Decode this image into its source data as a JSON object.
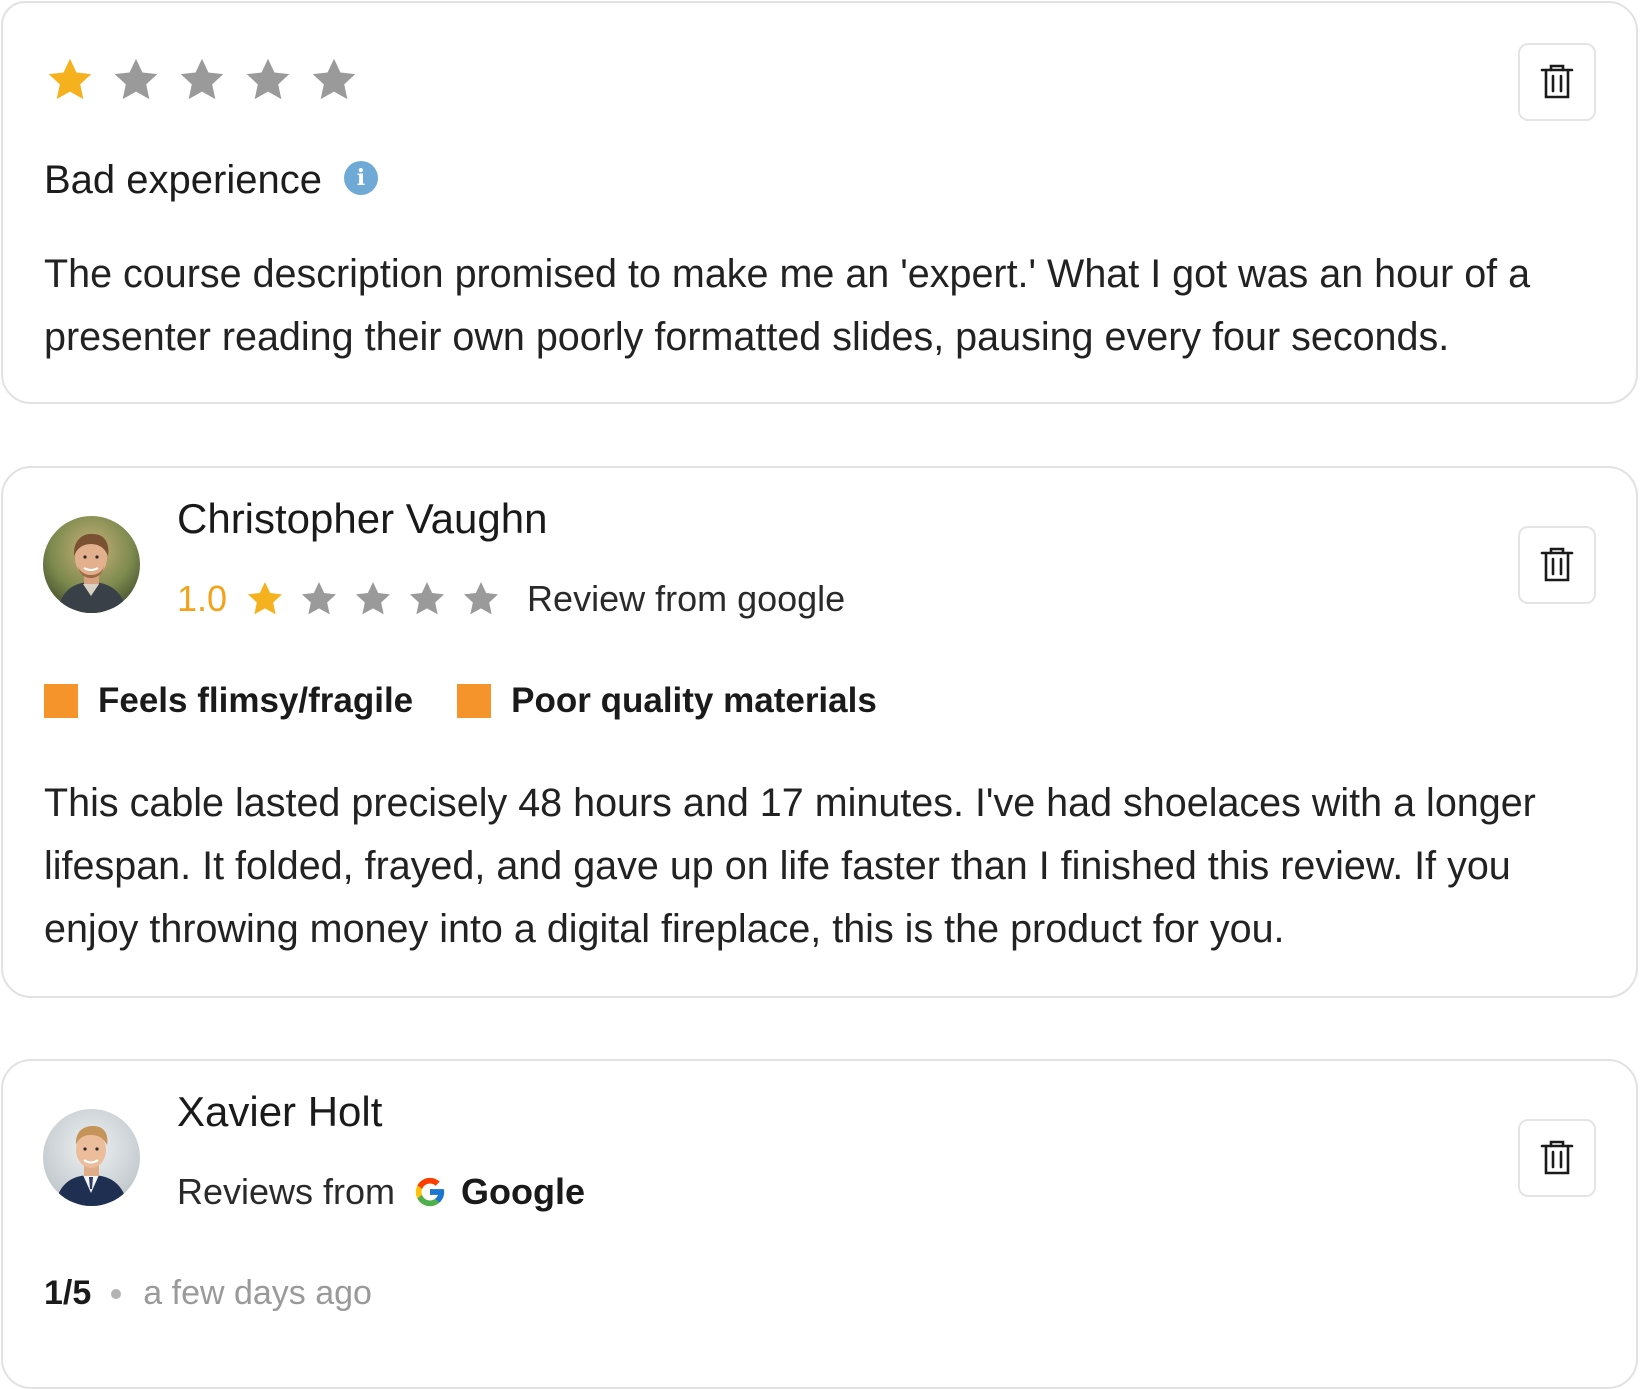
{
  "colors": {
    "star_filled": "#f5b21e",
    "star_empty": "#9a9a9a",
    "rating_accent": "#f2a31b",
    "tag_swatch": "#f5942a",
    "info_icon": "#6fa9d6"
  },
  "review1": {
    "rating": 1,
    "max_rating": 5,
    "title": "Bad experience",
    "info_icon": "info-icon",
    "body": "The course description promised to make me an 'expert.' What I got was an hour of a presenter reading their own poorly formatted slides, pausing every four seconds.",
    "delete_icon": "trash-icon"
  },
  "review2": {
    "name": "Christopher Vaughn",
    "rating_text": "1.0",
    "rating": 1,
    "max_rating": 5,
    "source": "Review from google",
    "tags": [
      {
        "label": "Feels flimsy/fragile"
      },
      {
        "label": "Poor quality materials"
      }
    ],
    "body": "This cable lasted precisely 48 hours and 17 minutes. I've had shoelaces with a longer lifespan. It folded, frayed, and gave up on life faster than I finished this review. If you enjoy throwing money into a digital fireplace, this is the product for you.",
    "delete_icon": "trash-icon"
  },
  "review3": {
    "name": "Xavier Holt",
    "reviews_from": "Reviews from",
    "platform": "Google",
    "platform_icon": "google-g-icon",
    "score": "1/5",
    "time": "a few days ago",
    "delete_icon": "trash-icon"
  }
}
